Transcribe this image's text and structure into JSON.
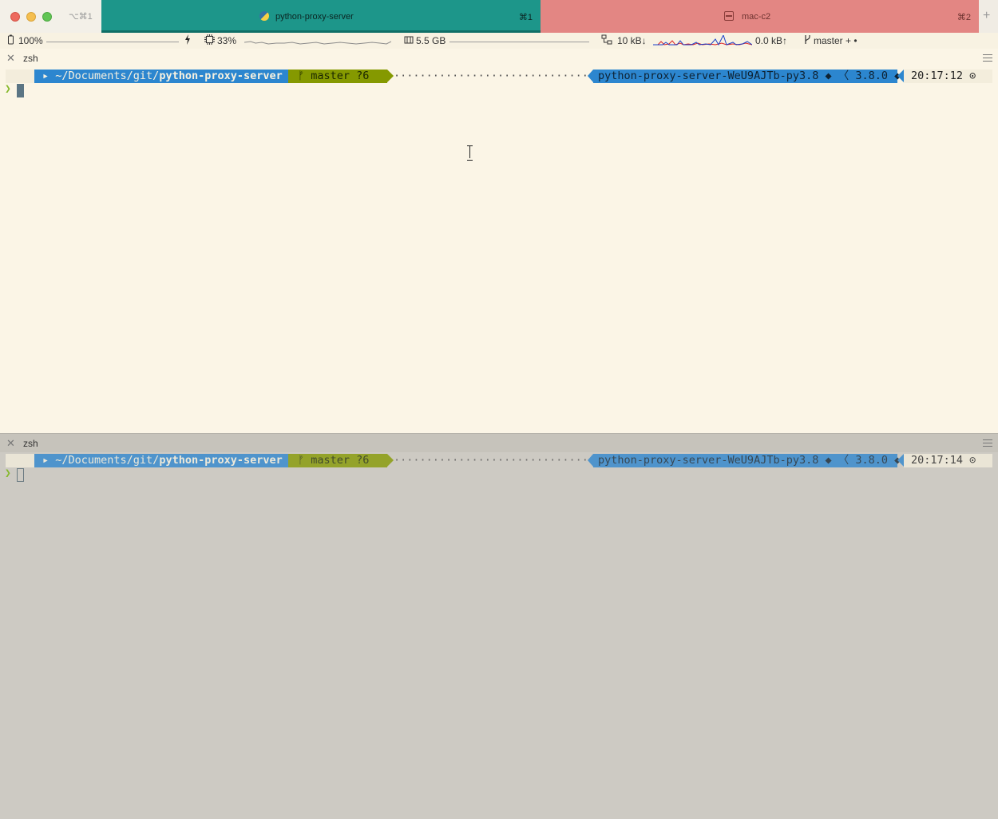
{
  "window": {
    "hotkey_label": "⌥⌘1"
  },
  "tabs": [
    {
      "title": "python-proxy-server",
      "shortcut": "⌘1",
      "icon": "python-icon",
      "color": "#1d968a",
      "active": true
    },
    {
      "title": "mac-c2",
      "shortcut": "⌘2",
      "icon": "drive-icon",
      "color": "#e38683",
      "active": false
    }
  ],
  "new_tab_label": "+",
  "status_bar": {
    "battery": "100%",
    "cpu": "33%",
    "memory": "5.5 GB",
    "net_down": "10 kB↓",
    "net_up": "0.0 kB↑",
    "git": "master + •"
  },
  "panes": [
    {
      "name": "zsh",
      "focused": true,
      "prompt": {
        "os_icon": "",
        "dir_prefix": "~/Documents/git/",
        "dir_name": "python-proxy-server",
        "git": "master ?6",
        "git_icon": "ᚠ",
        "dots": "··················································",
        "virtualenv": "python-proxy-server-WeU9AJTb-py3.8",
        "python_version": "3.8.0",
        "time": "20:17:12",
        "prompt_char": "❯"
      }
    },
    {
      "name": "zsh",
      "focused": false,
      "prompt": {
        "os_icon": "",
        "dir_prefix": "~/Documents/git/",
        "dir_name": "python-proxy-server",
        "git": "master ?6",
        "git_icon": "ᚠ",
        "dots": "··················································",
        "virtualenv": "python-proxy-server-WeU9AJTb-py3.8",
        "python_version": "3.8.0",
        "time": "20:17:14",
        "prompt_char": "❯"
      }
    }
  ]
}
